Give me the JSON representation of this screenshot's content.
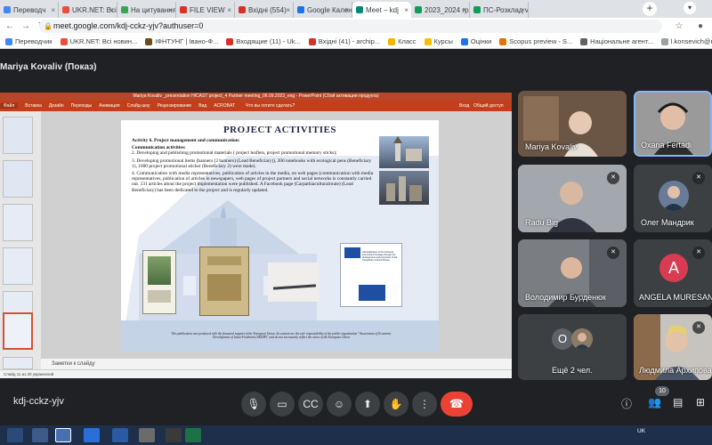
{
  "browser": {
    "tabs": [
      {
        "label": "Переводч",
        "color": "#4285f4"
      },
      {
        "label": "UKR.NET: Всі но",
        "color": "#e84e3b"
      },
      {
        "label": "На цитування -",
        "color": "#34a853"
      },
      {
        "label": "FILE VIEW",
        "color": "#d93025"
      },
      {
        "label": "Вхідні (554)",
        "color": "#d93025"
      },
      {
        "label": "Google Календа",
        "color": "#1a73e8"
      },
      {
        "label": "Meet – kdj",
        "color": "#00897b",
        "active": true
      },
      {
        "label": "2023_2024 граф",
        "color": "#0f9d58"
      },
      {
        "label": "ПС-Розклад v.2",
        "color": "#0f9d58"
      }
    ],
    "url": "meet.google.com/kdj-cckz-yjv?authuser=0",
    "bookmarks": [
      {
        "label": "Переводчик",
        "color": "#4285f4"
      },
      {
        "label": "UKR.NET: Всі новин...",
        "color": "#e84e3b"
      },
      {
        "label": "ІФНТУНГ | Івано-Ф...",
        "color": "#6b4e16"
      },
      {
        "label": "Входящие (11) - Uk...",
        "color": "#d93025"
      },
      {
        "label": "Вхідні (41) - archip...",
        "color": "#d93025"
      },
      {
        "label": "Класс",
        "color": "#f4b400"
      },
      {
        "label": "Курсы",
        "color": "#fbbc04"
      },
      {
        "label": "Оцінки",
        "color": "#1a73e8"
      },
      {
        "label": "Scopus preview - S...",
        "color": "#e37400"
      },
      {
        "label": "Національне агент...",
        "color": "#5f6368"
      },
      {
        "label": "l.konsevich@nung.e...",
        "color": "#9aa0a6"
      }
    ]
  },
  "meet": {
    "presenter_label": "Mariya Kovaliv (Показ)",
    "meeting_code": "kdj-cckz-yjv",
    "participant_count": "10",
    "more_label": "Ещё 2 чел.",
    "participants": [
      {
        "name": "Mariya Kovaliv",
        "bg": "#5c4a3a",
        "muted": false
      },
      {
        "name": "Oxana Fertadi",
        "bg": "#8c8c8c",
        "muted": false
      },
      {
        "name": "Radu Big",
        "bg": "#9a9ea6",
        "muted": true
      },
      {
        "name": "Олег Мандрик",
        "bg": "#3c4043",
        "muted": true
      },
      {
        "name": "Володимир Бурденюк",
        "bg": "#6b7078",
        "muted": true
      },
      {
        "name": "ANGELA MURESAN",
        "bg": "#3c4043",
        "muted": true,
        "initial": "A",
        "avatar_color": "#d93c52"
      },
      {
        "name": "Людмила Архипова",
        "bg": "#4a4e54",
        "muted": true
      }
    ],
    "avatar_o_initial": "O"
  },
  "powerpoint": {
    "title_bar": "Mariya Kovaliv _presentation HICAST project_4 Partner meeting_06.09.2023_eng - PowerPoint (Сбой активации продукта)",
    "ribbon": [
      "Файл",
      "Вставка",
      "Дизайн",
      "Переходы",
      "Анимация",
      "Слайд-шоу",
      "Рецензирование",
      "Вид",
      "ACROBAT",
      "Что вы хотите сделать?"
    ],
    "ribbon_right": [
      "Вход",
      "Общий доступ"
    ],
    "notes_placeholder": "Заметки к слайду",
    "status": "Слайд 11 из 20    украинский",
    "slide": {
      "title": "PROJECT ACTIVITIES",
      "heading": "Activity 6. Project management and communication:",
      "subheading": "Communication activities:",
      "items": [
        "2. Developing and publishing promotional materials ( project leaflets, project promotional memory sticks);",
        "3. Developing promotional items (banners (2 banners) (Lead Beneficiary)), 200 notebooks with ecological pens (Beneficiary 1), 1000 project promotional sticker (Beneficiary 2) were made).",
        "4. Communication with media representatives, publication of articles in the media, on web pages (communication with media representatives, publication of articles in newspapers, web pages of project partners and social networks is constantly carried out. 131 articles about the project implementation were published. A Facebook page (Carpathiaculturalroute) (Lead Beneficiary) has been dedicated to the project and is regularly updated."
      ],
      "footer": "This publication was produced with the financial support of the European Union. Its content are the sole responsibility of the public organization \"Association of Economic Development of Ivano-Frankivsk (AEDIF)\" and do not necessarily reflect the views of the European Union",
      "poster_text": "«Revitalization of the historical and cultural heritage through the development and promotion of the Carpathian Cultural Route»"
    }
  },
  "taskbar": {
    "tray": "UK"
  }
}
